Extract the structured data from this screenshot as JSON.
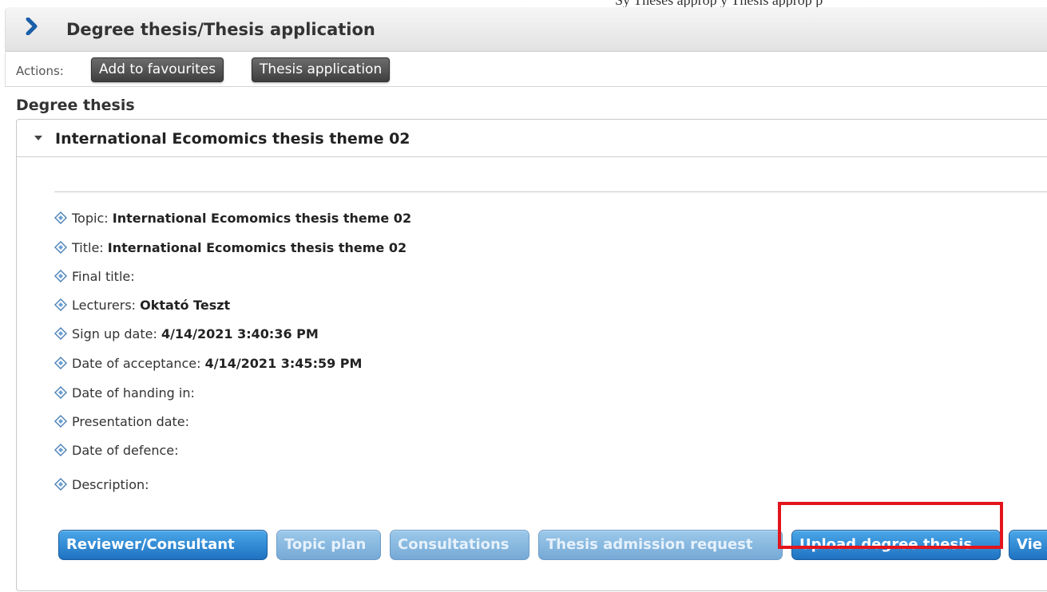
{
  "top_banner": "Sy Theses           approp  y         Thesis approp  p",
  "header": {
    "title": "Degree thesis/Thesis application",
    "icon": "chevron-right-icon"
  },
  "actions": {
    "label": "Actions:",
    "buttons": [
      "Add to favourites",
      "Thesis application"
    ]
  },
  "section": {
    "title": "Degree thesis"
  },
  "thesis": {
    "name": "International Ecomomics thesis theme 02",
    "fields": [
      {
        "label": "Topic:",
        "value": "International Ecomomics thesis theme 02"
      },
      {
        "label": "Title:",
        "value": "International Ecomomics thesis theme 02"
      },
      {
        "label": "Final title:",
        "value": ""
      },
      {
        "label": "Lecturers:",
        "value": "Oktató Teszt"
      },
      {
        "label": "Sign up date:",
        "value": "4/14/2021 3:40:36 PM"
      },
      {
        "label": "Date of acceptance:",
        "value": "4/14/2021 3:45:59 PM"
      },
      {
        "label": "Date of handing in:",
        "value": ""
      },
      {
        "label": "Presentation date:",
        "value": ""
      },
      {
        "label": "Date of defence:",
        "value": ""
      },
      {
        "label": "Description:",
        "value": ""
      }
    ]
  },
  "buttons": [
    {
      "label": "Reviewer/Consultant",
      "enabled": true
    },
    {
      "label": "Topic plan",
      "enabled": false
    },
    {
      "label": "Consultations",
      "enabled": false
    },
    {
      "label": "Thesis admission request",
      "enabled": false
    },
    {
      "label": "Upload degree thesis",
      "enabled": true,
      "highlighted": true
    },
    {
      "label": "Vie",
      "enabled": true
    }
  ],
  "colors": {
    "primary_button": "#2a86d6",
    "disabled_button": "#8fbde3",
    "highlight": "#e3141b"
  }
}
